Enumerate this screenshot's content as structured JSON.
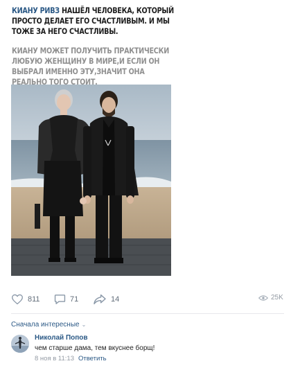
{
  "post": {
    "mention": "КИАНУ РИВЗ",
    "line1_rest": " НАШЁЛ ЧЕЛОВЕКА, КОТОРЫЙ ПРОСТО ДЕЛАЕТ ЕГО СЧАСТЛИВЫМ. И МЫ ТОЖЕ ЗА НЕГО СЧАСТЛИВЫ.",
    "paragraph2": "КИАНУ МОЖЕТ ПОЛУЧИТЬ ПРАКТИЧЕСКИ ЛЮБУЮ ЖЕНЩИНУ В МИРЕ,И ЕСЛИ ОН ВЫБРАЛ ИМЕННО ЭТУ,ЗНАЧИТ ОНА РЕАЛЬНО ТОГО СТОИТ."
  },
  "actions": {
    "likes": "811",
    "comments": "71",
    "shares": "14",
    "views": "25K"
  },
  "comments_sort": "Сначала интересные",
  "comment": {
    "author": "Николай Попов",
    "text": "чем старше дама, тем вкуснее борщ!",
    "date": "8 ноя в 11:13",
    "reply_label": "Ответить"
  },
  "colors": {
    "link": "#2a5885",
    "muted": "#939aa3",
    "divider": "#e7e8ec"
  },
  "icons": [
    "heart-icon",
    "comment-icon",
    "share-icon",
    "eye-icon",
    "chevron-down-icon"
  ]
}
